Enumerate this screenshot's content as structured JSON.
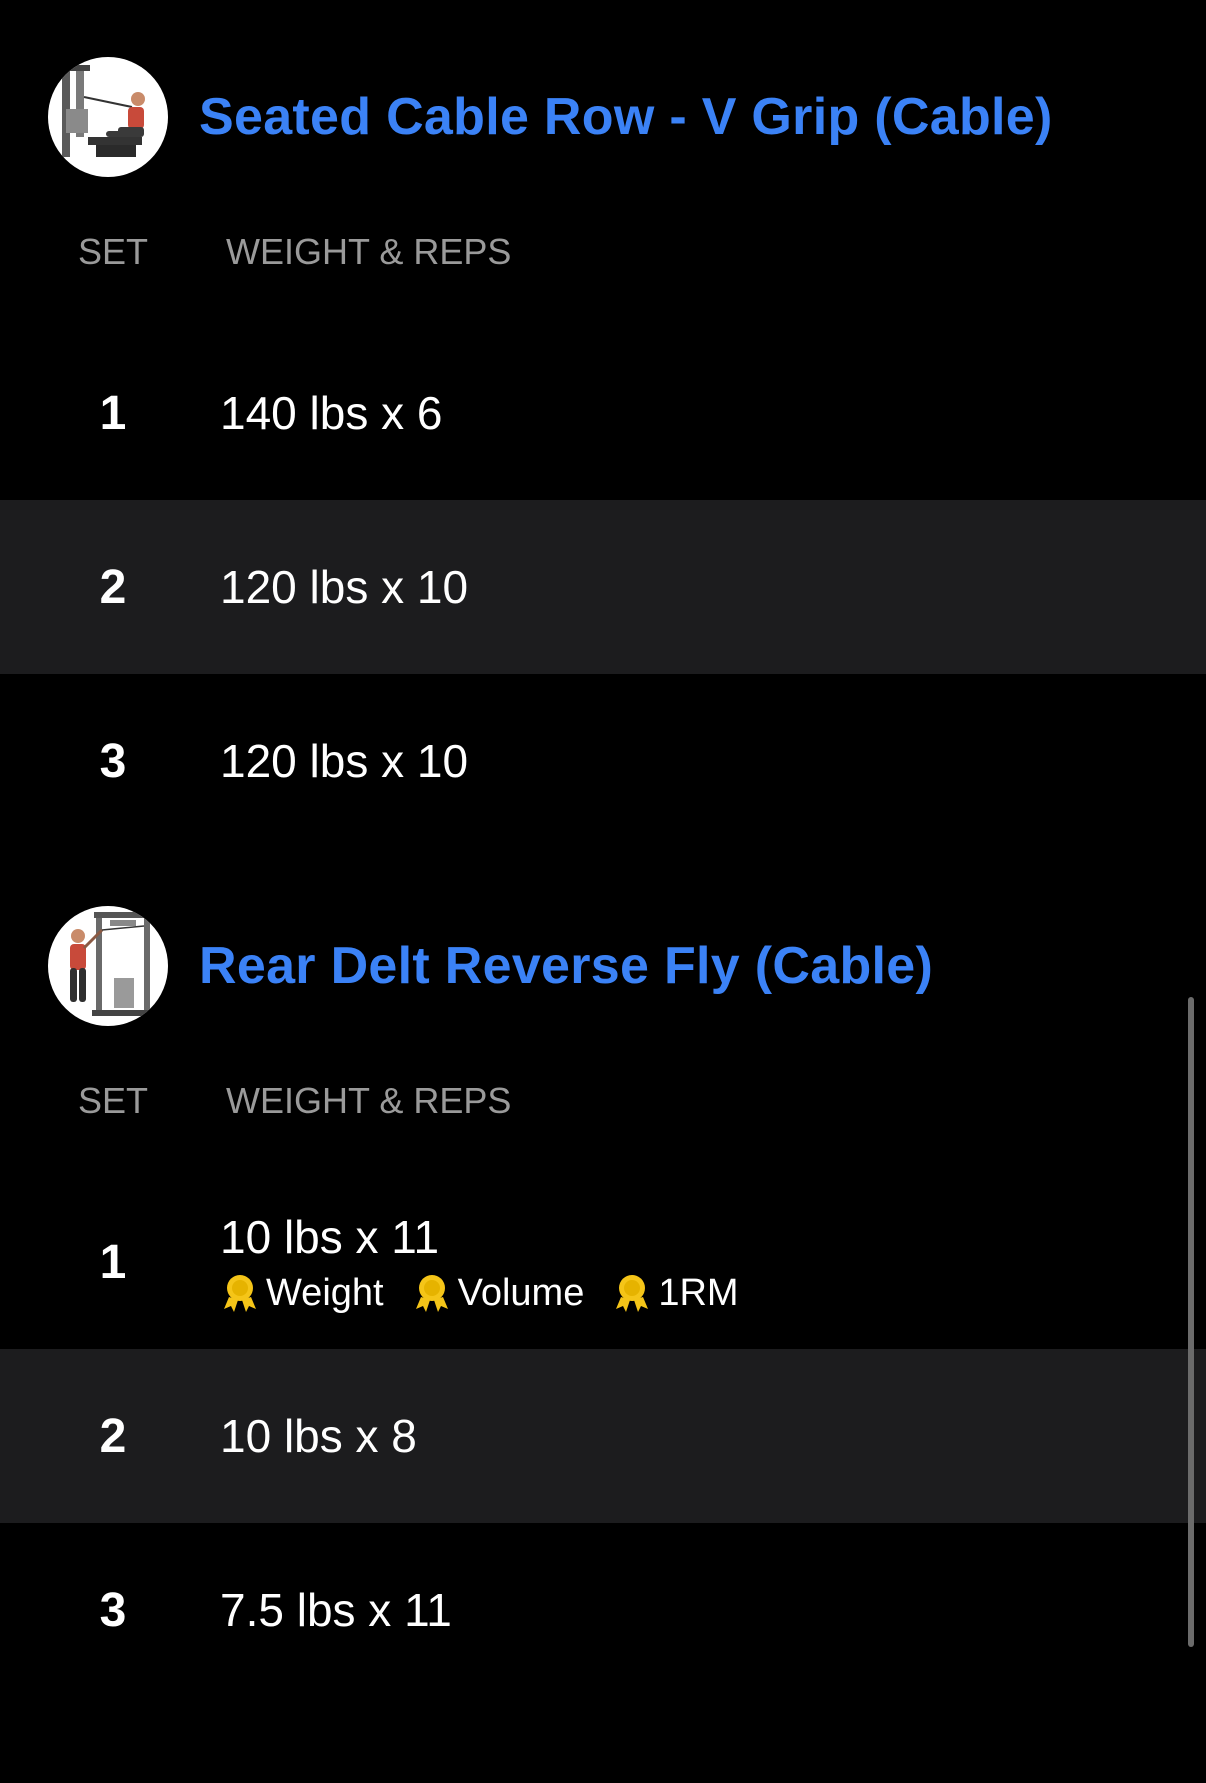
{
  "colors": {
    "background": "#000000",
    "alt_row": "#1c1c1e",
    "title": "#3b82f6",
    "header_text": "#9a9a9a",
    "badge": "#f5c518"
  },
  "columns": {
    "set": "SET",
    "weight_reps": "WEIGHT & REPS"
  },
  "exercises": [
    {
      "title": "Seated Cable Row - V Grip (Cable)",
      "thumbnail_icon": "seated-cable-row-illustration",
      "sets": [
        {
          "set": "1",
          "value": "140 lbs x 6"
        },
        {
          "set": "2",
          "value": "120 lbs x 10"
        },
        {
          "set": "3",
          "value": "120 lbs x 10"
        }
      ]
    },
    {
      "title": "Rear Delt Reverse Fly (Cable)",
      "thumbnail_icon": "rear-delt-fly-illustration",
      "sets": [
        {
          "set": "1",
          "value": "10 lbs x 11",
          "badges": [
            {
              "icon": "medal-icon",
              "label": "Weight"
            },
            {
              "icon": "medal-icon",
              "label": "Volume"
            },
            {
              "icon": "medal-icon",
              "label": "1RM"
            }
          ]
        },
        {
          "set": "2",
          "value": "10 lbs x 8"
        },
        {
          "set": "3",
          "value": "7.5 lbs x 11"
        }
      ]
    }
  ]
}
